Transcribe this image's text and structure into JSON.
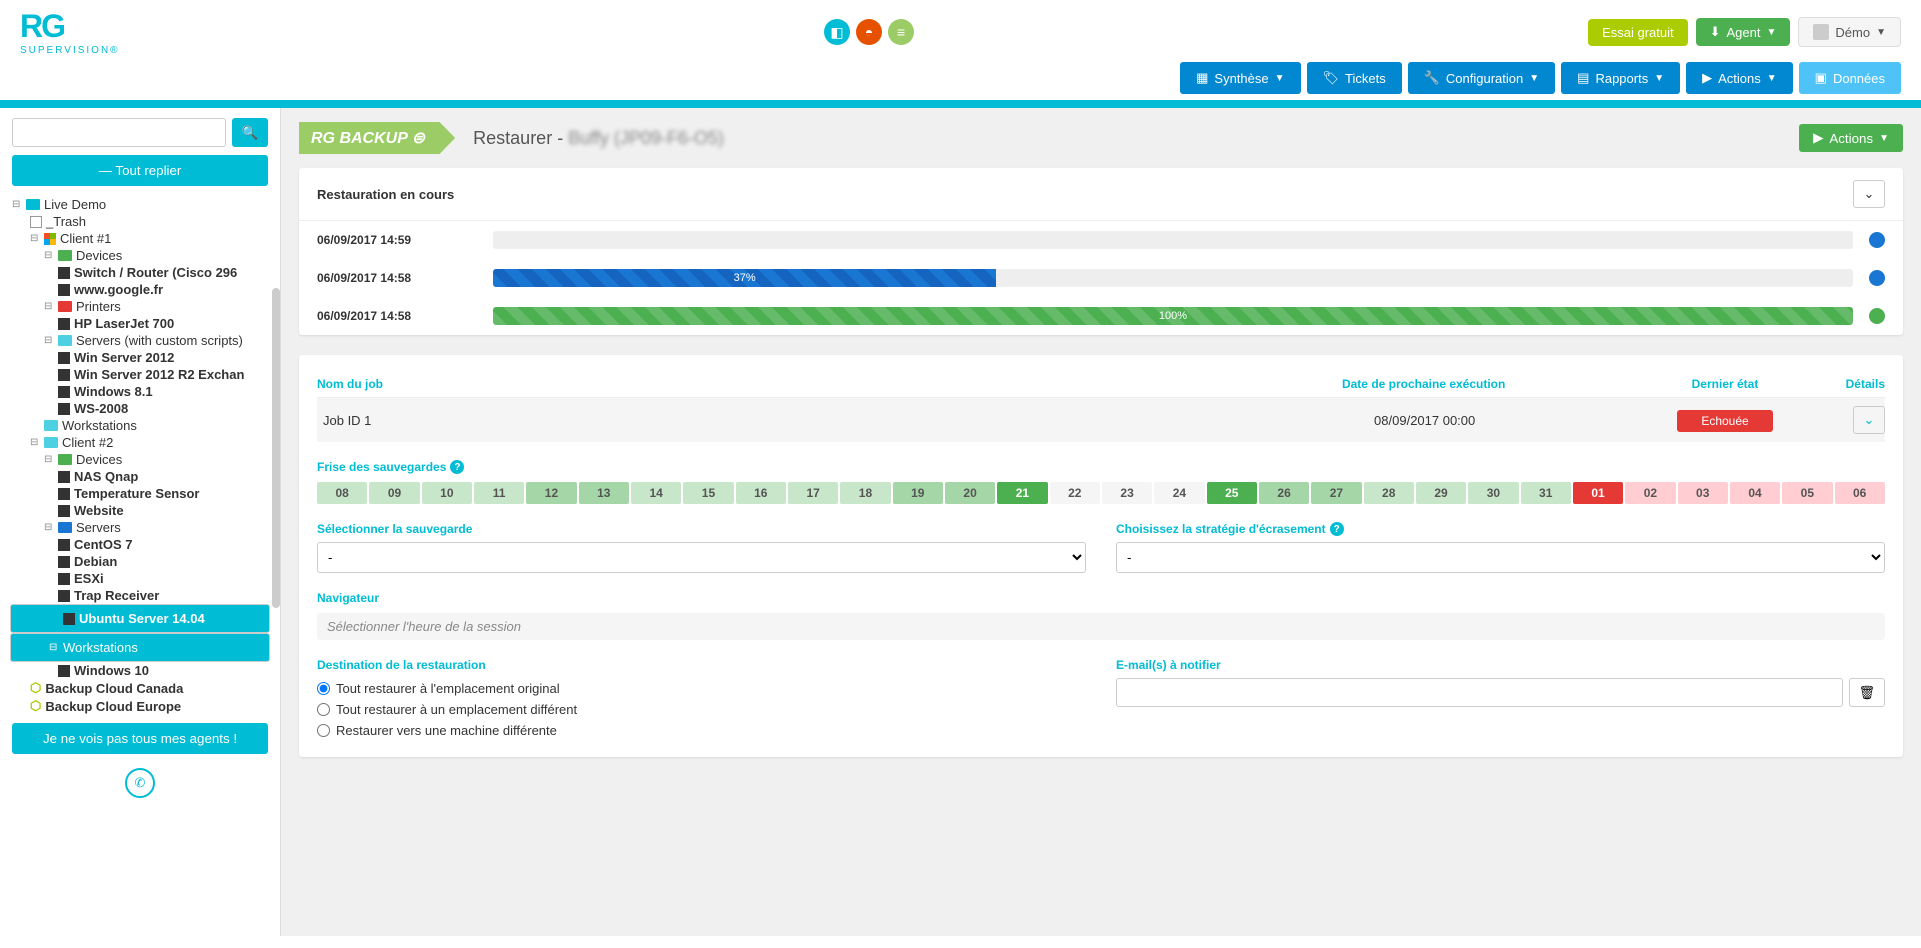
{
  "top": {
    "trial": "Essai gratuit",
    "agent": "Agent",
    "user": "Démo"
  },
  "nav": {
    "synthese": "Synthèse",
    "tickets": "Tickets",
    "config": "Configuration",
    "rapports": "Rapports",
    "actions": "Actions",
    "donnees": "Données"
  },
  "sidebar": {
    "collapse": "Tout replier",
    "agents": "Je ne vois pas tous mes agents !",
    "tree": {
      "root": "Live Demo",
      "trash": "_Trash",
      "client1": "Client #1",
      "devices1": "Devices",
      "switch": "Switch / Router (Cisco 296",
      "google": "www.google.fr",
      "printers": "Printers",
      "hp": "HP LaserJet 700",
      "servers1": "Servers (with custom scripts)",
      "win2012": "Win Server 2012",
      "win2012r2": "Win Server 2012 R2 Exchan",
      "win81": "Windows 8.1",
      "ws2008": "WS-2008",
      "workstations1": "Workstations",
      "client2": "Client #2",
      "devices2": "Devices",
      "nas": "NAS Qnap",
      "temp": "Temperature Sensor",
      "website": "Website",
      "servers2": "Servers",
      "centos": "CentOS 7",
      "debian": "Debian",
      "esxi": "ESXi",
      "trap": "Trap Receiver",
      "ubuntu": "Ubuntu Server 14.04",
      "workstations2": "Workstations",
      "win10": "Windows 10",
      "bcanada": "Backup Cloud Canada",
      "beurope": "Backup Cloud Europe"
    }
  },
  "page": {
    "badge": "RG BACKUP",
    "title_prefix": "Restaurer - ",
    "title_host": "Buffy (JP09-F6-O5)",
    "actions": "Actions"
  },
  "resto": {
    "title": "Restauration en cours",
    "rows": [
      {
        "time": "06/09/2017 14:59",
        "pct": 0,
        "color": "#1976d2",
        "label": ""
      },
      {
        "time": "06/09/2017 14:58",
        "pct": 37,
        "color": "#1976d2",
        "label": "37%"
      },
      {
        "time": "06/09/2017 14:58",
        "pct": 100,
        "color": "#4caf50",
        "label": "100%"
      }
    ]
  },
  "jobs": {
    "h_name": "Nom du job",
    "h_date": "Date de prochaine exécution",
    "h_state": "Dernier état",
    "h_details": "Détails",
    "row": {
      "name": "Job ID 1",
      "date": "08/09/2017 00:00",
      "state": "Echouée"
    }
  },
  "cal": {
    "title": "Frise des sauvegardes",
    "days": [
      {
        "d": "08",
        "c": "cd-lg"
      },
      {
        "d": "09",
        "c": "cd-lg"
      },
      {
        "d": "10",
        "c": "cd-lg"
      },
      {
        "d": "11",
        "c": "cd-lg"
      },
      {
        "d": "12",
        "c": "cd-mg"
      },
      {
        "d": "13",
        "c": "cd-mg"
      },
      {
        "d": "14",
        "c": "cd-lg"
      },
      {
        "d": "15",
        "c": "cd-lg"
      },
      {
        "d": "16",
        "c": "cd-lg"
      },
      {
        "d": "17",
        "c": "cd-lg"
      },
      {
        "d": "18",
        "c": "cd-lg"
      },
      {
        "d": "19",
        "c": "cd-mg"
      },
      {
        "d": "20",
        "c": "cd-mg"
      },
      {
        "d": "21",
        "c": "cd-dg"
      },
      {
        "d": "22",
        "c": "cd-w"
      },
      {
        "d": "23",
        "c": "cd-w"
      },
      {
        "d": "24",
        "c": "cd-w"
      },
      {
        "d": "25",
        "c": "cd-dg"
      },
      {
        "d": "26",
        "c": "cd-mg"
      },
      {
        "d": "27",
        "c": "cd-mg"
      },
      {
        "d": "28",
        "c": "cd-lg"
      },
      {
        "d": "29",
        "c": "cd-lg"
      },
      {
        "d": "30",
        "c": "cd-lg"
      },
      {
        "d": "31",
        "c": "cd-lg"
      },
      {
        "d": "01",
        "c": "cd-r"
      },
      {
        "d": "02",
        "c": "cd-lr"
      },
      {
        "d": "03",
        "c": "cd-lr"
      },
      {
        "d": "04",
        "c": "cd-lr"
      },
      {
        "d": "05",
        "c": "cd-lr"
      },
      {
        "d": "06",
        "c": "cd-lr"
      }
    ]
  },
  "form": {
    "select_backup": "Sélectionner la sauvegarde",
    "strategy": "Choisissez la stratégie d'écrasement",
    "dash": "-",
    "nav": "Navigateur",
    "nav_ph": "Sélectionner l'heure de la session",
    "dest": "Destination de la restauration",
    "r1": "Tout restaurer à l'emplacement original",
    "r2": "Tout restaurer à un emplacement différent",
    "r3": "Restaurer vers une machine différente",
    "email": "E-mail(s) à notifier"
  }
}
